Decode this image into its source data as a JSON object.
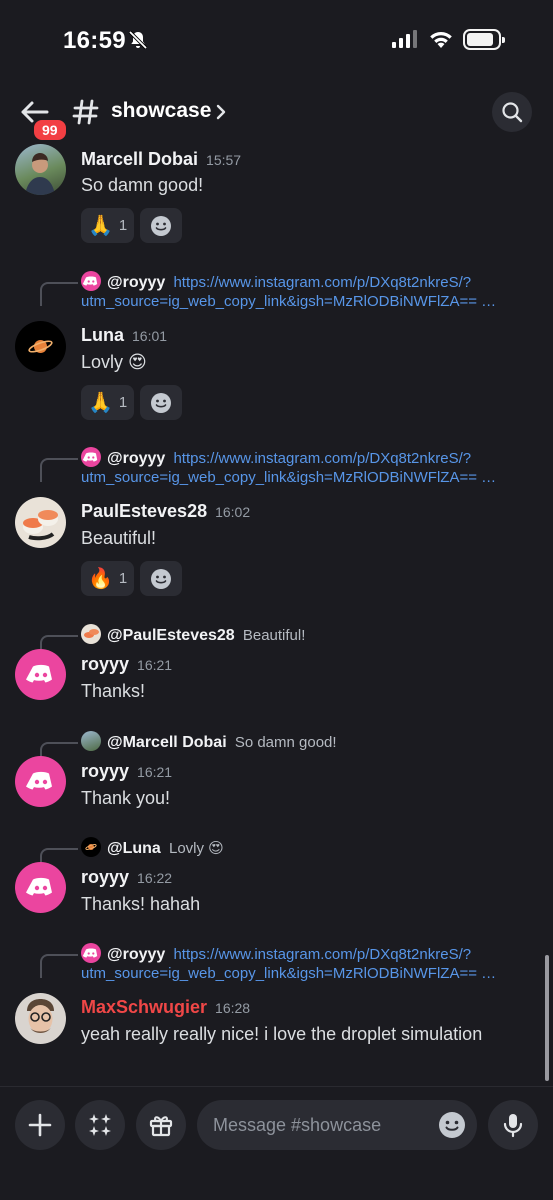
{
  "status": {
    "time": "16:59"
  },
  "header": {
    "back_badge": "99",
    "channel": "showcase"
  },
  "messages": [
    {
      "author": "Marcell Dobai",
      "time": "15:57",
      "text": "So damn good!",
      "reaction": {
        "emoji": "🙏",
        "count": "1"
      }
    },
    {
      "reply_to": "@royyy",
      "reply_link_1": "https://www.instagram.com/p/DXq8t2nkreS/?",
      "reply_link_2": "utm_source=ig_web_copy_link&igsh=MzRlODBiNWFlZA== …",
      "author": "Luna",
      "time": "16:01",
      "text": "Lovly 😍",
      "reaction": {
        "emoji": "🙏",
        "count": "1"
      }
    },
    {
      "reply_to": "@royyy",
      "reply_link_1": "https://www.instagram.com/p/DXq8t2nkreS/?",
      "reply_link_2": "utm_source=ig_web_copy_link&igsh=MzRlODBiNWFlZA== …",
      "author": "PaulEsteves28",
      "time": "16:02",
      "text": "Beautiful!",
      "reaction": {
        "emoji": "🔥",
        "count": "1"
      }
    },
    {
      "reply_to": "@PaulEsteves28",
      "reply_text": "Beautiful!",
      "author": "royyy",
      "time": "16:21",
      "text": "Thanks!"
    },
    {
      "reply_to": "@Marcell Dobai",
      "reply_text": "So damn good!",
      "author": "royyy",
      "time": "16:21",
      "text": "Thank you!"
    },
    {
      "reply_to": "@Luna",
      "reply_text": "Lovly 😍",
      "author": "royyy",
      "time": "16:22",
      "text": "Thanks! hahah"
    },
    {
      "reply_to": "@royyy",
      "reply_link_1": "https://www.instagram.com/p/DXq8t2nkreS/?",
      "reply_link_2": "utm_source=ig_web_copy_link&igsh=MzRlODBiNWFlZA== …",
      "author": "MaxSchwugier",
      "time": "16:28",
      "text": "yeah really really nice! i love the droplet simulation"
    }
  ],
  "composer": {
    "placeholder": "Message #showcase"
  },
  "colors": {
    "accent_pink": "#eb459f",
    "link": "#5896e8",
    "name_red": "#f04747",
    "badge_red": "#f23f43"
  },
  "icons": [
    "back-arrow-icon",
    "hash-icon",
    "chevron-right-icon",
    "search-icon",
    "add-reaction-icon",
    "plus-icon",
    "apps-icon",
    "gift-icon",
    "emoji-icon",
    "microphone-icon"
  ]
}
